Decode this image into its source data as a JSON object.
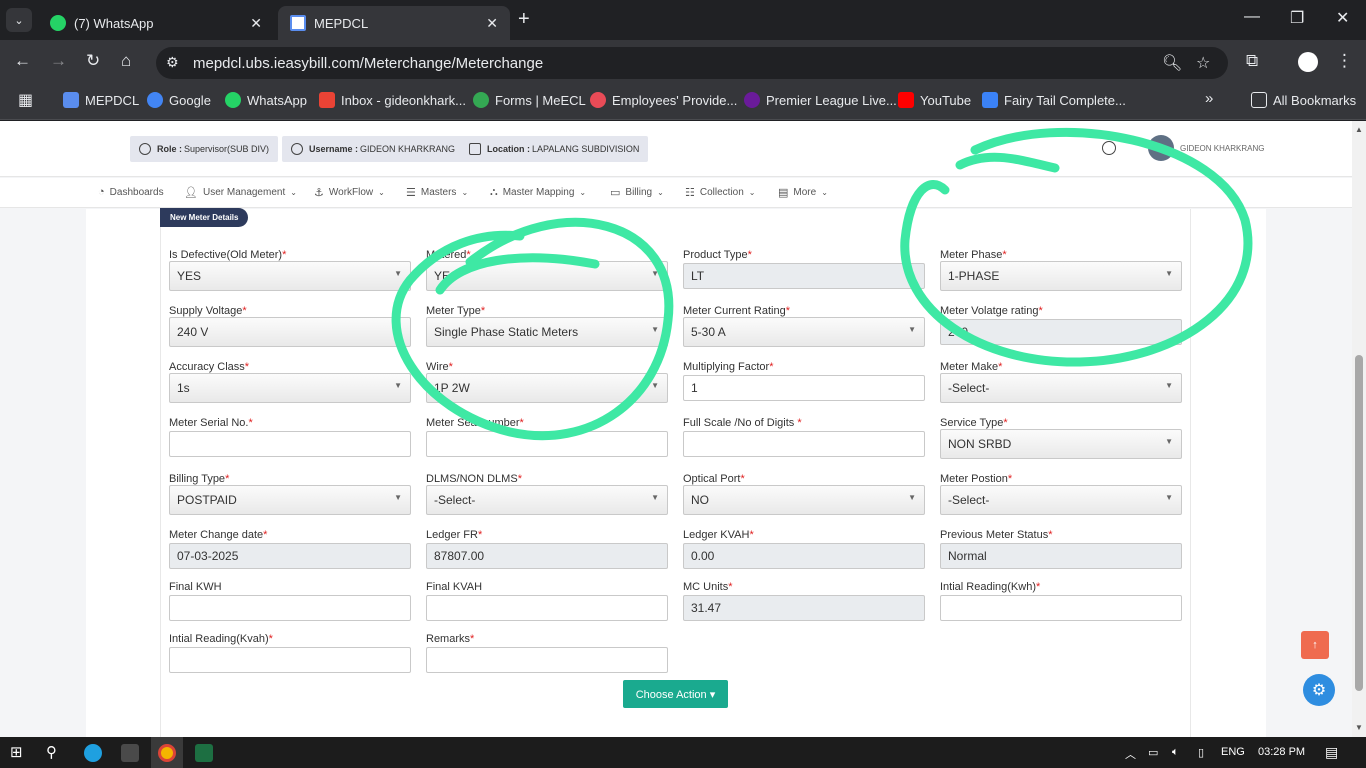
{
  "browser": {
    "tabs": [
      {
        "title": "(7) WhatsApp",
        "icon": "whatsapp-icon",
        "active": false
      },
      {
        "title": "MEPDCL",
        "icon": "page-icon",
        "active": true
      }
    ],
    "url": "mepdcl.ubs.ieasybill.com/Meterchange/Meterchange",
    "bookmarks": [
      {
        "label": "MEPDCL",
        "color": "#5a8dee"
      },
      {
        "label": "Google",
        "color": "#4285f4"
      },
      {
        "label": "WhatsApp",
        "color": "#25d366"
      },
      {
        "label": "Inbox - gideonkhark...",
        "color": "#ea4335"
      },
      {
        "label": "Forms | MeECL",
        "color": "#34a853"
      },
      {
        "label": "Employees' Provide...",
        "color": "#e94b57"
      },
      {
        "label": "Premier League Live...",
        "color": "#6a1b9a"
      },
      {
        "label": "YouTube",
        "color": "#ff0000"
      },
      {
        "label": "Fairy Tail Complete...",
        "color": "#3b82f6"
      }
    ],
    "all_bookmarks": "All Bookmarks"
  },
  "header": {
    "role_label": "Role :",
    "role_value": "Supervisor(SUB DIV)",
    "username_label": "Username :",
    "username_value": "GIDEON KHARKRANG",
    "location_label": "Location :",
    "location_value": "LAPALANG SUBDIVISION",
    "user_display": "GIDEON KHARKRANG"
  },
  "menu": [
    {
      "label": "Dashboards",
      "icon": "dashboard-icon",
      "dropdown": false
    },
    {
      "label": "User Management",
      "icon": "user-icon",
      "dropdown": true
    },
    {
      "label": "WorkFlow",
      "icon": "workflow-icon",
      "dropdown": true
    },
    {
      "label": "Masters",
      "icon": "masters-icon",
      "dropdown": true
    },
    {
      "label": "Master Mapping",
      "icon": "mapping-icon",
      "dropdown": true
    },
    {
      "label": "Billing",
      "icon": "billing-icon",
      "dropdown": true
    },
    {
      "label": "Collection",
      "icon": "collection-icon",
      "dropdown": true
    },
    {
      "label": "More",
      "icon": "more-icon",
      "dropdown": true
    }
  ],
  "section_title": "New Meter Details",
  "fields": [
    {
      "label": "Is Defective(Old Meter)",
      "required": true,
      "type": "select",
      "value": "YES"
    },
    {
      "label": "Metered",
      "required": true,
      "type": "select",
      "value": "YES"
    },
    {
      "label": "Product Type",
      "required": true,
      "type": "readonly",
      "value": "LT"
    },
    {
      "label": "Meter Phase",
      "required": true,
      "type": "select",
      "value": "1-PHASE"
    },
    {
      "label": "Supply Voltage",
      "required": true,
      "type": "select",
      "value": "240 V"
    },
    {
      "label": "Meter Type",
      "required": true,
      "type": "select",
      "value": "Single Phase Static Meters"
    },
    {
      "label": "Meter Current Rating",
      "required": true,
      "type": "select",
      "value": "5-30 A"
    },
    {
      "label": "Meter Volatge rating",
      "required": true,
      "type": "readonly",
      "value": "240"
    },
    {
      "label": "Accuracy Class",
      "required": true,
      "type": "select",
      "value": "1s"
    },
    {
      "label": "Wire",
      "required": true,
      "type": "select",
      "value": "1P 2W"
    },
    {
      "label": "Multiplying Factor",
      "required": true,
      "type": "input",
      "value": "1"
    },
    {
      "label": "Meter Make",
      "required": true,
      "type": "select",
      "value": "-Select-"
    },
    {
      "label": "Meter Serial No.",
      "required": true,
      "type": "input",
      "value": ""
    },
    {
      "label": "Meter Seal number",
      "required": true,
      "type": "input",
      "value": ""
    },
    {
      "label": "Full Scale /No of Digits ",
      "required": true,
      "type": "input",
      "value": ""
    },
    {
      "label": "Service Type",
      "required": true,
      "type": "select",
      "value": "NON SRBD"
    },
    {
      "label": "Billing Type",
      "required": true,
      "type": "select",
      "value": "POSTPAID"
    },
    {
      "label": "DLMS/NON DLMS",
      "required": true,
      "type": "select",
      "value": "-Select-"
    },
    {
      "label": "Optical Port",
      "required": true,
      "type": "select",
      "value": "NO"
    },
    {
      "label": "Meter Postion",
      "required": true,
      "type": "select",
      "value": "-Select-"
    },
    {
      "label": "Meter Change date",
      "required": true,
      "type": "readonly",
      "value": "07-03-2025"
    },
    {
      "label": "Ledger FR",
      "required": true,
      "type": "readonly",
      "value": "87807.00"
    },
    {
      "label": "Ledger KVAH",
      "required": true,
      "type": "readonly",
      "value": "0.00"
    },
    {
      "label": "Previous Meter Status",
      "required": true,
      "type": "readonly",
      "value": "Normal"
    },
    {
      "label": "Final KWH",
      "required": false,
      "type": "input",
      "value": ""
    },
    {
      "label": "Final KVAH",
      "required": false,
      "type": "input",
      "value": ""
    },
    {
      "label": "MC Units",
      "required": true,
      "type": "readonly",
      "value": "31.47"
    },
    {
      "label": "Intial Reading(Kwh)",
      "required": true,
      "type": "input",
      "value": ""
    },
    {
      "label": "Intial Reading(Kvah)",
      "required": true,
      "type": "input",
      "value": ""
    },
    {
      "label": "Remarks",
      "required": true,
      "type": "input",
      "value": ""
    }
  ],
  "action_button": "Choose Action ▾",
  "annotation_color": "#3ee8a4",
  "taskbar": {
    "lang": "ENG",
    "time": "03:28 PM"
  }
}
